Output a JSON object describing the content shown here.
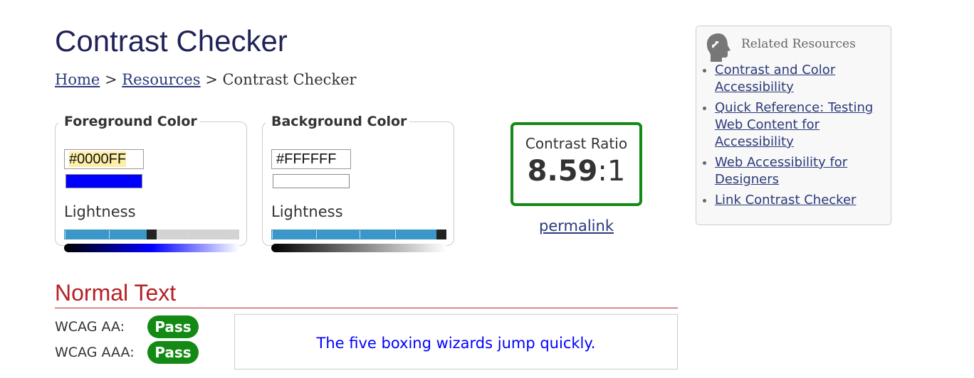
{
  "title": "Contrast Checker",
  "breadcrumb": {
    "home": "Home",
    "sep1": ">",
    "resources": "Resources",
    "sep2": ">",
    "current": "Contrast Checker"
  },
  "foreground": {
    "legend": "Foreground Color",
    "hex": "#0000FF",
    "color": "#0000FF",
    "lightness_label": "Lightness",
    "lightness_percent": 50
  },
  "background": {
    "legend": "Background Color",
    "hex": "#FFFFFF",
    "color": "#FFFFFF",
    "lightness_label": "Lightness",
    "lightness_percent": 100
  },
  "ratio": {
    "label": "Contrast Ratio",
    "value": "8.59",
    "suffix": ":1",
    "border_color": "#138a13"
  },
  "permalink": "permalink",
  "sidebar": {
    "title": "Related Resources",
    "icon": "head-link-icon",
    "links": [
      "Contrast and Color Accessibility",
      "Quick Reference: Testing Web Content for Accessibility",
      "Web Accessibility for Designers",
      "Link Contrast Checker"
    ]
  },
  "normal_text": {
    "heading": "Normal Text",
    "aa_label": "WCAG AA:",
    "aa_result": "Pass",
    "aaa_label": "WCAG AAA:",
    "aaa_result": "Pass",
    "sample": "The five boxing wizards jump quickly.",
    "pass_color": "#138a13"
  }
}
